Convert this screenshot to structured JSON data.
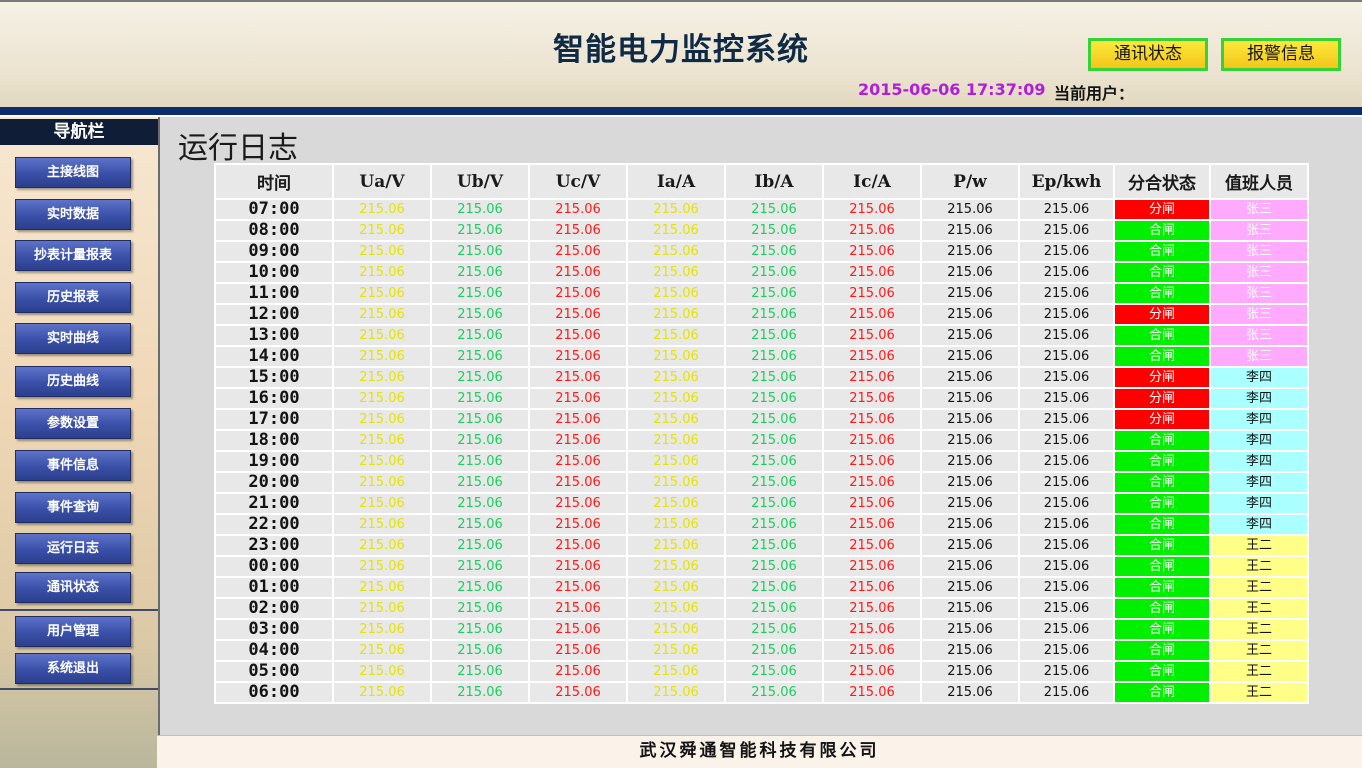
{
  "header": {
    "title": "智能电力监控系统",
    "btn_comm": "通讯状态",
    "btn_alarm": "报警信息",
    "datetime": "2015-06-06 17:37:09",
    "user_label": "当前用户："
  },
  "sidebar": {
    "title": "导航栏",
    "items": [
      {
        "label": "主接线图",
        "name": "sidebar-item-main-wiring"
      },
      {
        "label": "实时数据",
        "name": "sidebar-item-realtime-data"
      },
      {
        "label": "抄表计量报表",
        "name": "sidebar-item-metering-report"
      },
      {
        "label": "历史报表",
        "name": "sidebar-item-history-report"
      },
      {
        "label": "实时曲线",
        "name": "sidebar-item-realtime-curve"
      },
      {
        "label": "历史曲线",
        "name": "sidebar-item-history-curve"
      },
      {
        "label": "参数设置",
        "name": "sidebar-item-parameter-settings"
      },
      {
        "label": "事件信息",
        "name": "sidebar-item-event-info"
      },
      {
        "label": "事件查询",
        "name": "sidebar-item-event-query"
      },
      {
        "label": "运行日志",
        "name": "sidebar-item-run-log"
      },
      {
        "label": "通讯状态",
        "name": "sidebar-item-comm-status"
      },
      {
        "label": "用户管理",
        "name": "sidebar-item-user-management"
      },
      {
        "label": "系统退出",
        "name": "sidebar-item-system-exit"
      }
    ]
  },
  "main": {
    "page_title": "运行日志",
    "columns": [
      "时间",
      "Ua/V",
      "Ub/V",
      "Uc/V",
      "Ia/A",
      "Ib/A",
      "Ic/A",
      "P/w",
      "Ep/kwh",
      "分合状态",
      "值班人员"
    ],
    "rows": [
      {
        "time": "07:00",
        "ua": "215.06",
        "ub": "215.06",
        "uc": "215.06",
        "ia": "215.06",
        "ib": "215.06",
        "ic": "215.06",
        "p": "215.06",
        "ep": "215.06",
        "state": "分闸",
        "duty": "张三"
      },
      {
        "time": "08:00",
        "ua": "215.06",
        "ub": "215.06",
        "uc": "215.06",
        "ia": "215.06",
        "ib": "215.06",
        "ic": "215.06",
        "p": "215.06",
        "ep": "215.06",
        "state": "合闸",
        "duty": "张三"
      },
      {
        "time": "09:00",
        "ua": "215.06",
        "ub": "215.06",
        "uc": "215.06",
        "ia": "215.06",
        "ib": "215.06",
        "ic": "215.06",
        "p": "215.06",
        "ep": "215.06",
        "state": "合闸",
        "duty": "张三"
      },
      {
        "time": "10:00",
        "ua": "215.06",
        "ub": "215.06",
        "uc": "215.06",
        "ia": "215.06",
        "ib": "215.06",
        "ic": "215.06",
        "p": "215.06",
        "ep": "215.06",
        "state": "合闸",
        "duty": "张三"
      },
      {
        "time": "11:00",
        "ua": "215.06",
        "ub": "215.06",
        "uc": "215.06",
        "ia": "215.06",
        "ib": "215.06",
        "ic": "215.06",
        "p": "215.06",
        "ep": "215.06",
        "state": "合闸",
        "duty": "张三"
      },
      {
        "time": "12:00",
        "ua": "215.06",
        "ub": "215.06",
        "uc": "215.06",
        "ia": "215.06",
        "ib": "215.06",
        "ic": "215.06",
        "p": "215.06",
        "ep": "215.06",
        "state": "分闸",
        "duty": "张三"
      },
      {
        "time": "13:00",
        "ua": "215.06",
        "ub": "215.06",
        "uc": "215.06",
        "ia": "215.06",
        "ib": "215.06",
        "ic": "215.06",
        "p": "215.06",
        "ep": "215.06",
        "state": "合闸",
        "duty": "张三"
      },
      {
        "time": "14:00",
        "ua": "215.06",
        "ub": "215.06",
        "uc": "215.06",
        "ia": "215.06",
        "ib": "215.06",
        "ic": "215.06",
        "p": "215.06",
        "ep": "215.06",
        "state": "合闸",
        "duty": "张三"
      },
      {
        "time": "15:00",
        "ua": "215.06",
        "ub": "215.06",
        "uc": "215.06",
        "ia": "215.06",
        "ib": "215.06",
        "ic": "215.06",
        "p": "215.06",
        "ep": "215.06",
        "state": "分闸",
        "duty": "李四"
      },
      {
        "time": "16:00",
        "ua": "215.06",
        "ub": "215.06",
        "uc": "215.06",
        "ia": "215.06",
        "ib": "215.06",
        "ic": "215.06",
        "p": "215.06",
        "ep": "215.06",
        "state": "分闸",
        "duty": "李四"
      },
      {
        "time": "17:00",
        "ua": "215.06",
        "ub": "215.06",
        "uc": "215.06",
        "ia": "215.06",
        "ib": "215.06",
        "ic": "215.06",
        "p": "215.06",
        "ep": "215.06",
        "state": "分闸",
        "duty": "李四"
      },
      {
        "time": "18:00",
        "ua": "215.06",
        "ub": "215.06",
        "uc": "215.06",
        "ia": "215.06",
        "ib": "215.06",
        "ic": "215.06",
        "p": "215.06",
        "ep": "215.06",
        "state": "合闸",
        "duty": "李四"
      },
      {
        "time": "19:00",
        "ua": "215.06",
        "ub": "215.06",
        "uc": "215.06",
        "ia": "215.06",
        "ib": "215.06",
        "ic": "215.06",
        "p": "215.06",
        "ep": "215.06",
        "state": "合闸",
        "duty": "李四"
      },
      {
        "time": "20:00",
        "ua": "215.06",
        "ub": "215.06",
        "uc": "215.06",
        "ia": "215.06",
        "ib": "215.06",
        "ic": "215.06",
        "p": "215.06",
        "ep": "215.06",
        "state": "合闸",
        "duty": "李四"
      },
      {
        "time": "21:00",
        "ua": "215.06",
        "ub": "215.06",
        "uc": "215.06",
        "ia": "215.06",
        "ib": "215.06",
        "ic": "215.06",
        "p": "215.06",
        "ep": "215.06",
        "state": "合闸",
        "duty": "李四"
      },
      {
        "time": "22:00",
        "ua": "215.06",
        "ub": "215.06",
        "uc": "215.06",
        "ia": "215.06",
        "ib": "215.06",
        "ic": "215.06",
        "p": "215.06",
        "ep": "215.06",
        "state": "合闸",
        "duty": "李四"
      },
      {
        "time": "23:00",
        "ua": "215.06",
        "ub": "215.06",
        "uc": "215.06",
        "ia": "215.06",
        "ib": "215.06",
        "ic": "215.06",
        "p": "215.06",
        "ep": "215.06",
        "state": "合闸",
        "duty": "王二"
      },
      {
        "time": "00:00",
        "ua": "215.06",
        "ub": "215.06",
        "uc": "215.06",
        "ia": "215.06",
        "ib": "215.06",
        "ic": "215.06",
        "p": "215.06",
        "ep": "215.06",
        "state": "合闸",
        "duty": "王二"
      },
      {
        "time": "01:00",
        "ua": "215.06",
        "ub": "215.06",
        "uc": "215.06",
        "ia": "215.06",
        "ib": "215.06",
        "ic": "215.06",
        "p": "215.06",
        "ep": "215.06",
        "state": "合闸",
        "duty": "王二"
      },
      {
        "time": "02:00",
        "ua": "215.06",
        "ub": "215.06",
        "uc": "215.06",
        "ia": "215.06",
        "ib": "215.06",
        "ic": "215.06",
        "p": "215.06",
        "ep": "215.06",
        "state": "合闸",
        "duty": "王二"
      },
      {
        "time": "03:00",
        "ua": "215.06",
        "ub": "215.06",
        "uc": "215.06",
        "ia": "215.06",
        "ib": "215.06",
        "ic": "215.06",
        "p": "215.06",
        "ep": "215.06",
        "state": "合闸",
        "duty": "王二"
      },
      {
        "time": "04:00",
        "ua": "215.06",
        "ub": "215.06",
        "uc": "215.06",
        "ia": "215.06",
        "ib": "215.06",
        "ic": "215.06",
        "p": "215.06",
        "ep": "215.06",
        "state": "合闸",
        "duty": "王二"
      },
      {
        "time": "05:00",
        "ua": "215.06",
        "ub": "215.06",
        "uc": "215.06",
        "ia": "215.06",
        "ib": "215.06",
        "ic": "215.06",
        "p": "215.06",
        "ep": "215.06",
        "state": "合闸",
        "duty": "王二"
      },
      {
        "time": "06:00",
        "ua": "215.06",
        "ub": "215.06",
        "uc": "215.06",
        "ia": "215.06",
        "ib": "215.06",
        "ic": "215.06",
        "p": "215.06",
        "ep": "215.06",
        "state": "合闸",
        "duty": "王二"
      }
    ]
  },
  "colors": {
    "header_bar": "#0d2c6e",
    "state_open": "#ff0000",
    "state_closed": "#00f000",
    "duty_zhang": "#ffaaff",
    "duty_li": "#aaffff",
    "duty_wang": "#ffff88",
    "datetime": "#b01edc"
  },
  "footer": {
    "company": "武汉舜通智能科技有限公司"
  }
}
